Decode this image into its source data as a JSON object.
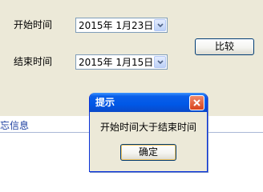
{
  "form": {
    "start_label": "开始时间",
    "start_value": "2015年 1月23日",
    "end_label": "结束时间",
    "end_value": "2015年 1月15日",
    "compare_button": "比较"
  },
  "background": {
    "section_text": "忘信息"
  },
  "dialog": {
    "title": "提示",
    "message": "开始时间大于结束时间",
    "ok_button": "确定"
  },
  "colors": {
    "panel_bg": "#ece9d8",
    "titlebar": "#0058e7",
    "close_button": "#d8431c",
    "link_text": "#1c3fa0"
  }
}
